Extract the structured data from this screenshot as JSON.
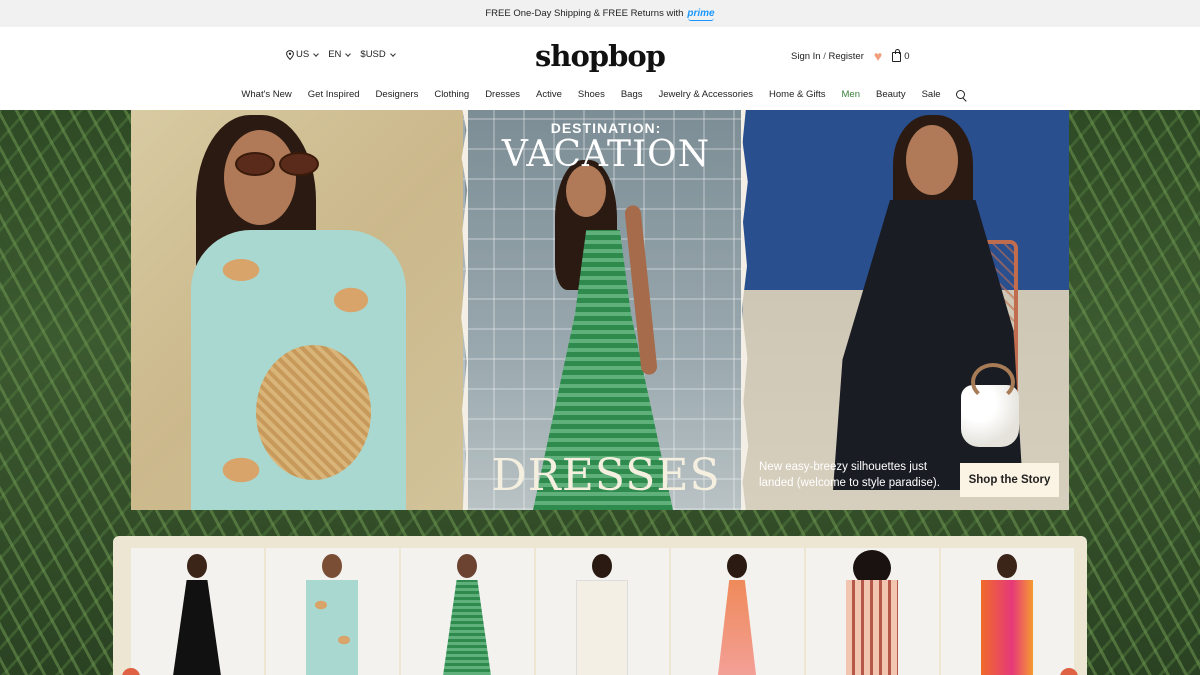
{
  "promo": {
    "text": "FREE One-Day Shipping & FREE Returns with",
    "prime": "prime"
  },
  "header": {
    "locale": {
      "country": "US",
      "language": "EN",
      "currency": "$USD"
    },
    "logo": "shopbop",
    "sign_in": "Sign In",
    "separator": "/",
    "register": "Register",
    "bag_count": "0"
  },
  "nav": {
    "items": [
      "What's New",
      "Get Inspired",
      "Designers",
      "Clothing",
      "Dresses",
      "Active",
      "Shoes",
      "Bags",
      "Jewelry & Accessories",
      "Home & Gifts",
      "Men",
      "Beauty",
      "Sale"
    ]
  },
  "hero": {
    "kicker": "DESTINATION:",
    "title_top": "VACATION",
    "title_bottom": "DRESSES",
    "tagline": "New easy-breezy silhouettes just landed (welcome to style paradise).",
    "cta": "Shop the Story"
  },
  "products": {
    "count": 7
  },
  "colors": {
    "promo_bg": "#f1f1f1",
    "prime_blue": "#1a98ff",
    "men_green": "#3a7d3a",
    "heart": "#f29d79",
    "cta_bg": "#fbf3e3",
    "strip_bg": "#ede6d2",
    "carousel_arrow": "#e06245"
  },
  "icons": [
    "location-pin-icon",
    "chevron-down-icon",
    "heart-icon",
    "shopping-bag-icon",
    "search-icon"
  ]
}
